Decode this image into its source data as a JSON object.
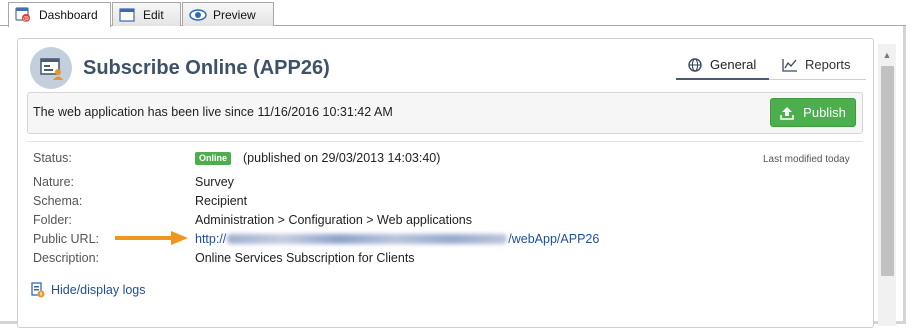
{
  "tabs": [
    {
      "label": "Dashboard",
      "icon": "dashboard-icon",
      "active": true
    },
    {
      "label": "Edit",
      "icon": "edit-window-icon",
      "active": false
    },
    {
      "label": "Preview",
      "icon": "eye-icon",
      "active": false
    }
  ],
  "header": {
    "title": "Subscribe Online (APP26)",
    "app_icon": "web-application-icon"
  },
  "view_tabs": {
    "general": "General",
    "reports": "Reports"
  },
  "live": {
    "text": "The web application has been live since 11/16/2016 10:31:42 AM",
    "publish_label": "Publish"
  },
  "details": {
    "status_label": "Status:",
    "status_badge": "Online",
    "published": "(published on 29/03/2013 14:03:40)",
    "last_modified": "Last modified today",
    "nature_label": "Nature:",
    "nature": "Survey",
    "schema_label": "Schema:",
    "schema": "Recipient",
    "folder_label": "Folder:",
    "folder": "Administration > Configuration > Web applications",
    "public_url_label": "Public URL:",
    "public_url_prefix": "http://",
    "public_url_suffix": "/webApp/APP26",
    "description_label": "Description:",
    "description": "Online Services Subscription for Clients"
  },
  "logs_link": "Hide/display logs",
  "colors": {
    "accent_green": "#4cae4c",
    "title_blue": "#3d5168",
    "link_blue": "#1f4e9b",
    "arrow_orange": "#f0961e"
  }
}
